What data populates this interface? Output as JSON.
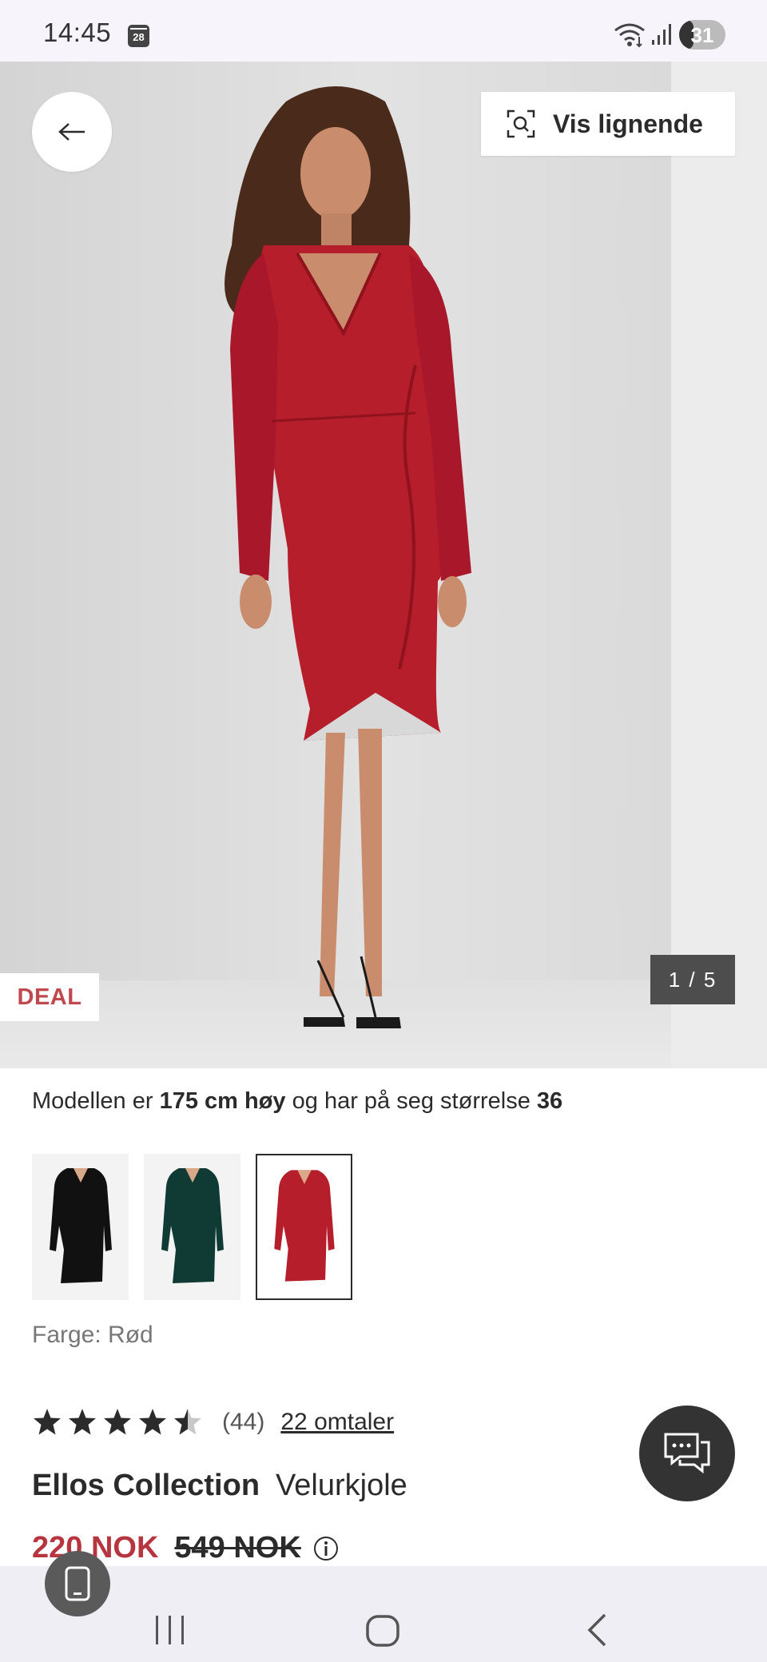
{
  "status_bar": {
    "time": "14:45",
    "calendar_day": "28",
    "battery_level": "31",
    "battery_fraction": 0.31
  },
  "hero": {
    "similar_button_label": "Vis lignende",
    "deal_badge": "DEAL",
    "image_counter": "1 / 5"
  },
  "product": {
    "model_info": {
      "prefix": "Modellen er ",
      "height": "175 cm høy",
      "middle": " og har på seg størrelse ",
      "size": "36"
    },
    "swatches": [
      {
        "color_name": "black",
        "color": "#111111"
      },
      {
        "color_name": "dark-green",
        "color": "#0f3b34"
      },
      {
        "color_name": "red",
        "color": "#b51e2a",
        "selected": true
      }
    ],
    "color_label": "Farge: Rød",
    "rating": 4.5,
    "rating_count": "(44)",
    "reviews_link": "22 omtaler",
    "brand": "Ellos Collection",
    "name": "Velurkjole",
    "price_now": "220 NOK",
    "price_old": "549 NOK"
  },
  "colors": {
    "deal": "#c0484f",
    "price": "#b6353f",
    "dress": "#b51e2a",
    "text": "#2b2b2b"
  },
  "icons": {
    "back": "arrow-left-icon",
    "similar": "visual-search-icon",
    "info": "info-icon",
    "chat": "chat-icon",
    "star": "star-icon"
  }
}
